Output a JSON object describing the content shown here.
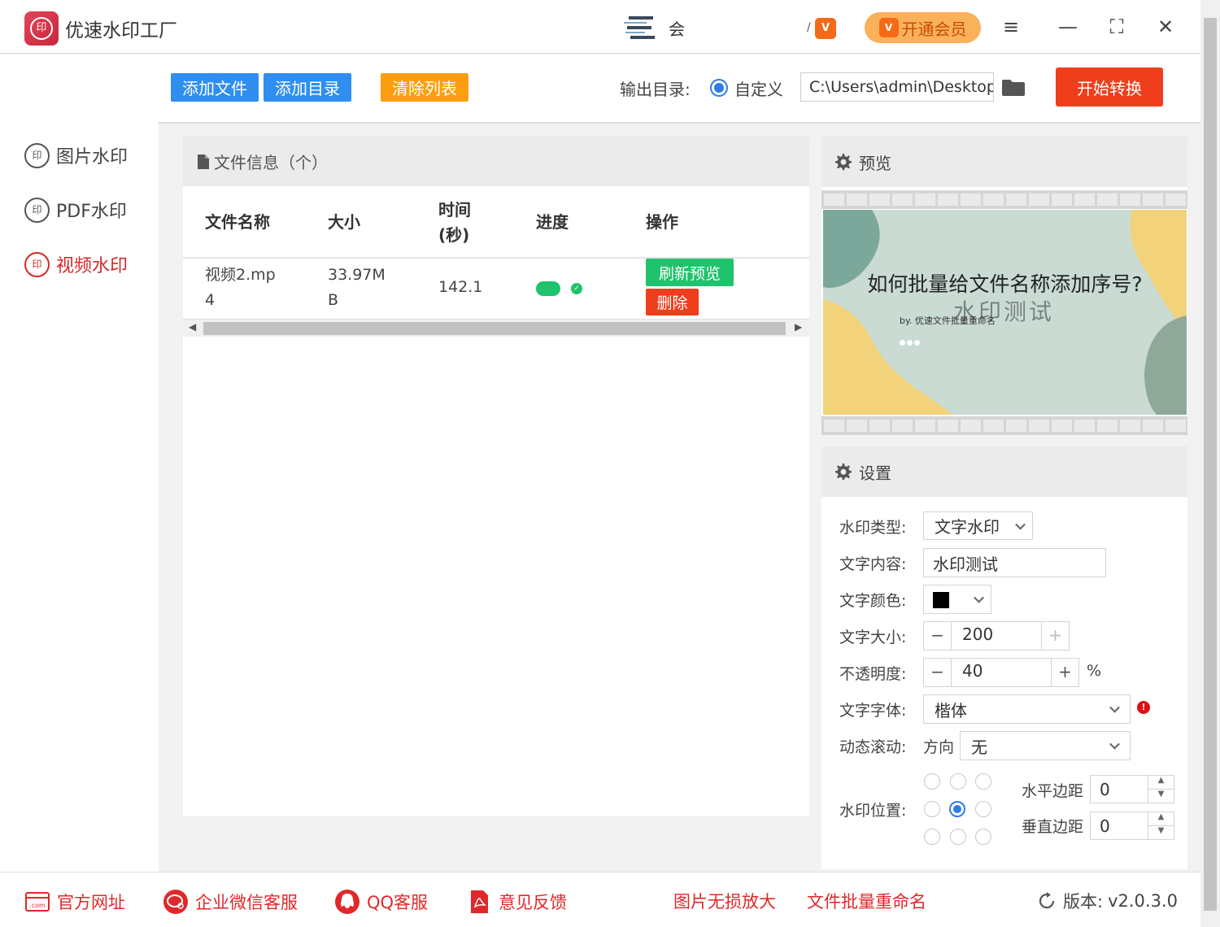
{
  "app": {
    "title": "优速水印工厂",
    "logo_text": "印",
    "member_text": "会",
    "vip_small_pre": "/",
    "vip_badge": "V",
    "vip_button": "开通会员",
    "menu_icon": "≡",
    "minimize_icon": "—",
    "maximize_icon": "⛶",
    "close_icon": "✕"
  },
  "sidebar": {
    "items": [
      {
        "label": "图片水印",
        "icon": "印"
      },
      {
        "label": "PDF水印",
        "icon": "印"
      },
      {
        "label": "视频水印",
        "icon": "印"
      }
    ]
  },
  "toolbar": {
    "add_file": "添加文件",
    "add_dir": "添加目录",
    "clear_list": "清除列表",
    "output_label": "输出目录:",
    "output_option": "自定义",
    "output_path": "C:\\Users\\admin\\Desktop",
    "start": "开始转换"
  },
  "files": {
    "header": "文件信息（个）",
    "columns": {
      "name": "文件名称",
      "size": "大小",
      "time_1": "时间",
      "time_2": "(秒)",
      "progress": "进度",
      "ops": "操作"
    },
    "rows": [
      {
        "name_1": "视频2.mp",
        "name_2": "4",
        "size_1": "33.97M",
        "size_2": "B",
        "time": "142.1",
        "progress_done": true,
        "refresh": "刷新预览",
        "delete": "删除"
      }
    ]
  },
  "preview": {
    "header": "预览",
    "slide_title": "如何批量给文件名称添加序号?",
    "slide_sub": "by. 优速文件批量重命名",
    "watermark": "水印测试"
  },
  "settings": {
    "header": "设置",
    "type_label": "水印类型:",
    "type_value": "文字水印",
    "content_label": "文字内容:",
    "content_value": "水印测试",
    "color_label": "文字颜色:",
    "color_value": "#000000",
    "size_label": "文字大小:",
    "size_value": "200",
    "opacity_label": "不透明度:",
    "opacity_value": "40",
    "percent": "%",
    "font_label": "文字字体:",
    "font_value": "楷体",
    "scroll_label": "动态滚动:",
    "direction_label": "方向",
    "direction_value": "无",
    "position_label": "水印位置:",
    "position_selected": 4,
    "h_margin_label": "水平边距",
    "h_margin_value": "0",
    "v_margin_label": "垂直边距",
    "v_margin_value": "0",
    "minus": "−",
    "plus": "+",
    "warn": "!"
  },
  "footer": {
    "website": "官方网址",
    "website_icon_text": ".com",
    "wechat": "企业微信客服",
    "qq": "QQ客服",
    "feedback": "意见反馈",
    "upscale": "图片无损放大",
    "rename": "文件批量重命名",
    "version_label": "版本:",
    "version_value": "v2.0.3.0"
  },
  "colors": {
    "blue": "#2f8ef0",
    "orange": "#fb9f10",
    "red": "#ef3e1c",
    "green": "#1fc36b",
    "accent_red": "#d5282a"
  }
}
